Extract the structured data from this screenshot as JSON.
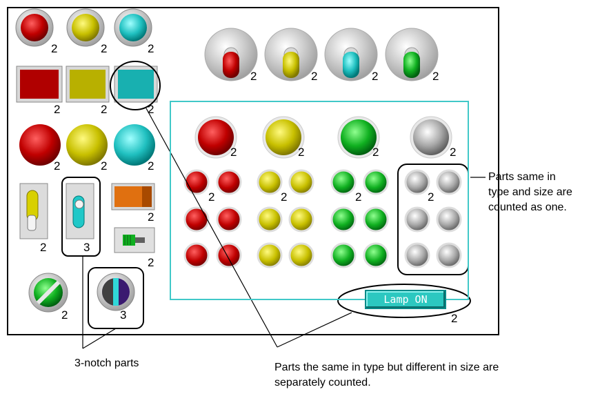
{
  "colors": {
    "red": "#c00000",
    "yellow": "#c8c000",
    "cyan": "#20c0c0",
    "green": "#10b020",
    "gray": "#a0a0a0",
    "orange": "#e07010",
    "frame": "#40c8c8"
  },
  "counts": {
    "round_red": "2",
    "round_yellow": "2",
    "round_cyan": "2",
    "square_red": "2",
    "square_yellow": "2",
    "square_cyan": "2",
    "big_red": "2",
    "big_yellow": "2",
    "big_cyan": "2",
    "toggle_yellow": "2",
    "toggle_cyan": "3",
    "orange_switch": "2",
    "green_slider": "2",
    "green_selector": "2",
    "blue_selector": "3",
    "lever_red": "2",
    "lever_yellow": "2",
    "lever_cyan": "2",
    "lever_green": "2",
    "lamp_red": "2",
    "lamp_yellow": "2",
    "lamp_green": "2",
    "lamp_gray": "2",
    "small_red": "2",
    "small_yellow": "2",
    "small_green": "2",
    "small_gray": "2",
    "lamp_on_button": "2"
  },
  "lamp_button": {
    "label": "Lamp ON"
  },
  "notes": {
    "same_type_size": [
      "Parts same in",
      "type and size are",
      "counted as one."
    ],
    "three_notch": "3-notch parts",
    "different_size": [
      "Parts the same in type but different in size are",
      "separately counted."
    ]
  }
}
